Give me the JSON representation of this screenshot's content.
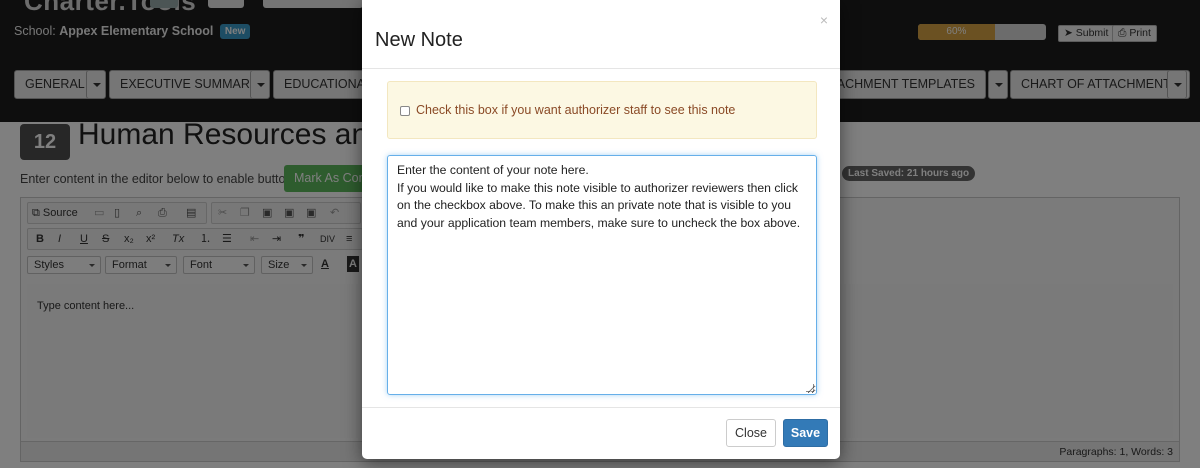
{
  "app": {
    "brand": "Charter.Tools"
  },
  "header": {
    "school_label": "School:",
    "school_name": "Appex Elementary School",
    "new_badge": "New",
    "progress_text": "60%",
    "progress_value": 0.6,
    "submit_label": "Submit",
    "print_label": "Print"
  },
  "nav": {
    "tabs": [
      {
        "label": "GENERAL"
      },
      {
        "label": "EXECUTIVE SUMMARY"
      },
      {
        "label": "EDUCATIONAL"
      },
      {
        "label": "ATTACHMENT TEMPLATES"
      },
      {
        "label": "CHART OF ATTACHMENTS"
      }
    ]
  },
  "section": {
    "number": "12",
    "title": "Human Resources an",
    "enter_text": "Enter content in the editor below to enable button",
    "mark_button": "Mark As Com",
    "last_saved": "Last Saved: 21 hours ago"
  },
  "editor": {
    "source_label": "Source",
    "styles_label": "Styles",
    "format_label": "Format",
    "font_label": "Font",
    "size_label": "Size",
    "placeholder": "Type content here...",
    "status": "Paragraphs: 1, Words: 3"
  },
  "modal": {
    "title": "New Note",
    "close_x": "×",
    "checkbox_label": "Check this box if you want authorizer staff to see this note",
    "note_lines": [
      "Enter the content of your note here.",
      "If you would like to make this note visible to authorizer reviewers then click on the checkbox above. To make this an private note that is visible to you and your application team members, make sure to uncheck the box above."
    ],
    "close_button": "Close",
    "save_button": "Save"
  },
  "colors": {
    "progress": "#d6a245",
    "save": "#337ab7",
    "notice_bg": "#fcf8e3",
    "notice_text": "#8a4a26",
    "mark_button": "#5cb85c"
  }
}
